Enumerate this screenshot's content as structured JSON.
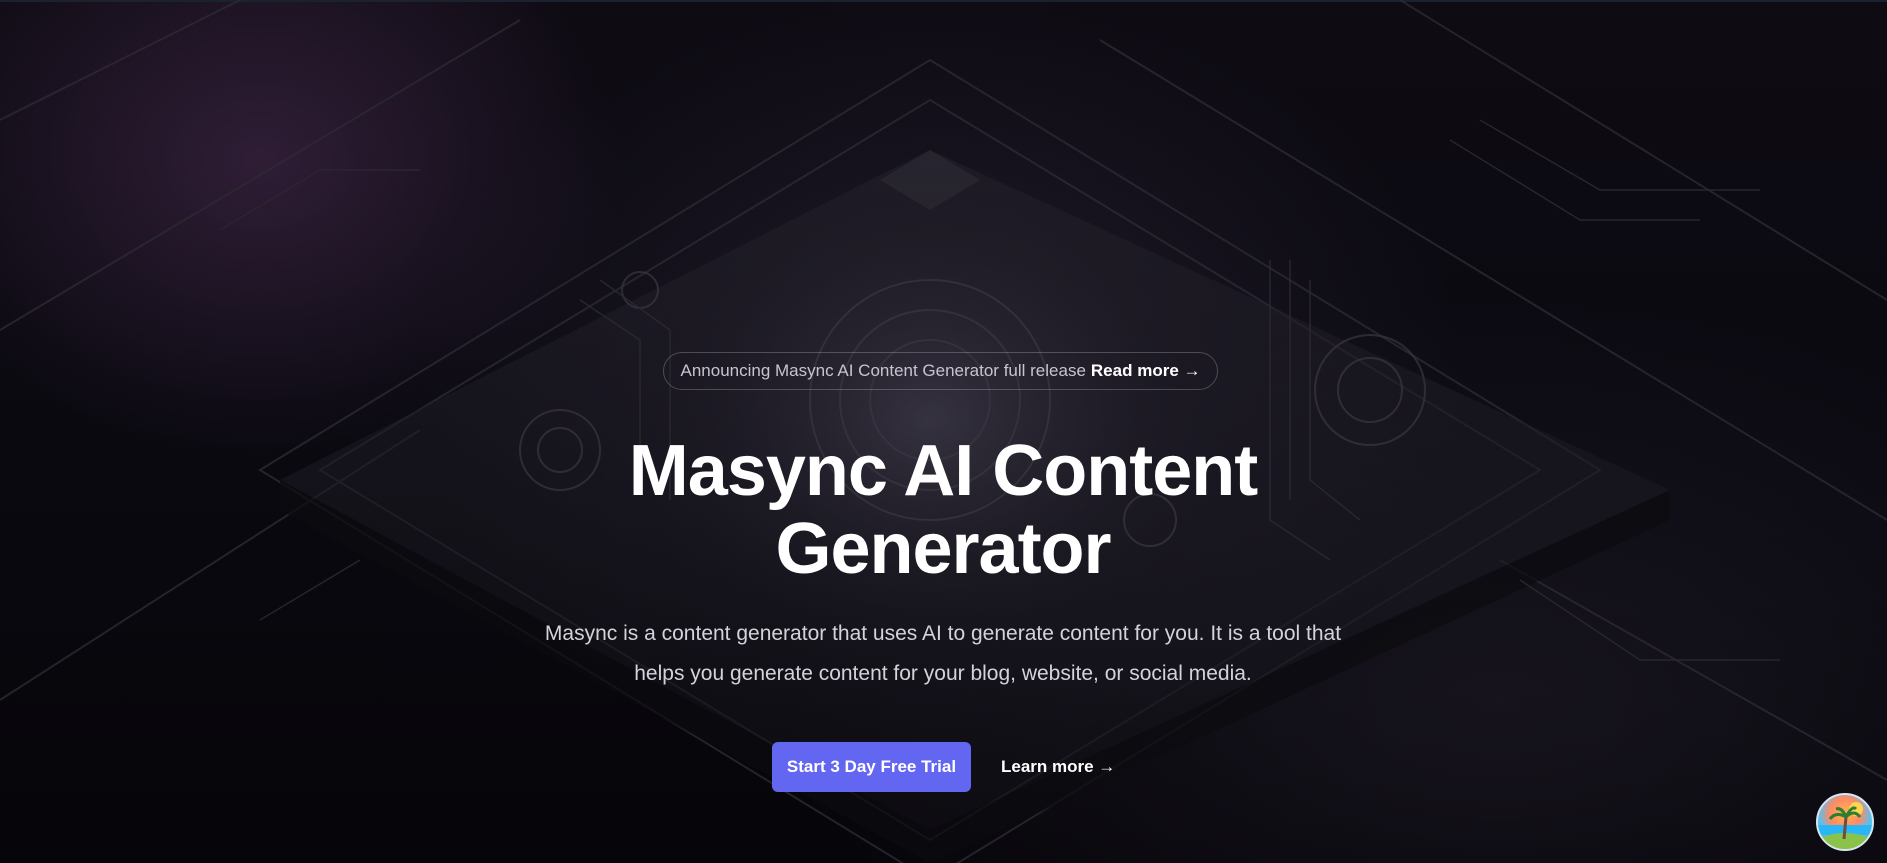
{
  "announcement": {
    "text": "Announcing Masync AI Content Generator full release",
    "link_label": "Read more →"
  },
  "hero": {
    "title_line1": "Masync AI Content",
    "title_line2": "Generator",
    "subtitle": "Masync is a content generator that uses AI to generate content for you. It is a tool that helps you generate content for your blog, website, or social media."
  },
  "cta": {
    "primary_label": "Start 3 Day Free Trial",
    "secondary_label": "Learn more →"
  },
  "widget": {
    "icon": "beach-palm-icon"
  },
  "colors": {
    "accent": "#6366f1",
    "background": "#0a0910",
    "text": "#ffffff"
  }
}
